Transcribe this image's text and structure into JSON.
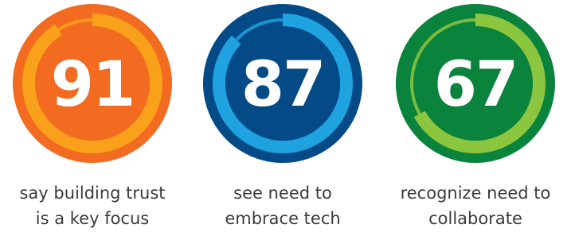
{
  "chart_data": {
    "type": "gauge",
    "unit": "%",
    "max": 100,
    "items": [
      {
        "value": 91,
        "label_lines": [
          "say building trust",
          "is a key focus"
        ],
        "colors": {
          "outer": "#f26b21",
          "ring_track": "#f9a11b",
          "ring_progress": "#f9a11b"
        }
      },
      {
        "value": 87,
        "label_lines": [
          "see need to",
          "embrace tech"
        ],
        "colors": {
          "outer": "#034a86",
          "ring_track": "#1fa2e0",
          "ring_progress": "#1fa2e0"
        }
      },
      {
        "value": 67,
        "label_lines": [
          "recognize need to",
          "collaborate"
        ],
        "colors": {
          "outer": "#0a833d",
          "ring_track": "#8cc63f",
          "ring_progress": "#8cc63f"
        }
      }
    ]
  }
}
